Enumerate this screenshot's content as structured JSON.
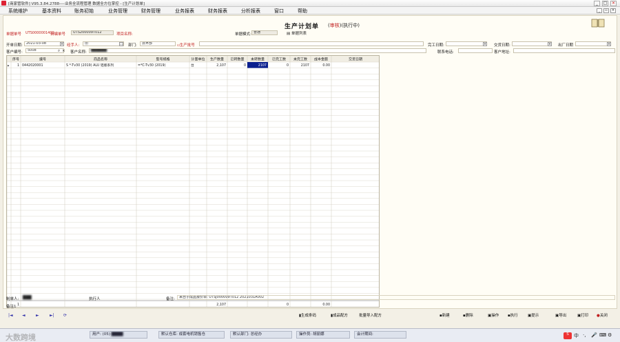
{
  "window": {
    "title": "[商家管软件] V95.3.84.2788----业务全流程管理 数据全方位掌控 - [生产计划单]",
    "controls": [
      "_",
      "□",
      "×"
    ]
  },
  "menu": {
    "items": [
      "系统维护",
      "基本资料",
      "账务初始",
      "业务管理",
      "财务管理",
      "业务报表",
      "财务报表",
      "分析报表",
      "窗口",
      "帮助"
    ]
  },
  "document": {
    "title": "生产计划单",
    "status_open": "(",
    "status_audit": "审核",
    "status_close": ")(执行中)",
    "doc_no_label": "单据单号",
    "doc_no_value": "UTS0000001409",
    "self_no_label": "自编单号",
    "self_no_value": "UTS200009T012",
    "project_label": "项目名称:",
    "mode_label": "单据模式:",
    "mode_value": "普通",
    "doc_list_label": "单据列表",
    "open_date_label": "开单日期:",
    "open_date_value": "2021-03-08",
    "handler_label": "经手人:",
    "handler_value": "曹",
    "dept_label": "部门:",
    "dept_value": "技术部",
    "batch_label": "生产批号",
    "finish_date_label": "完工日期:",
    "delivery_date_label": "交货日期:",
    "factory_date_label": "出厂日期",
    "customer_no_label": "客户编号:",
    "customer_no_value": "5008",
    "customer_name_label": "客户名称:",
    "contact_phone_label": "联系电话:",
    "customer_addr_label": "客户地址:"
  },
  "grid": {
    "columns": [
      "序号",
      "编号",
      "商品名称",
      "型号规格",
      "计量单位",
      "生产数量",
      "已转数量",
      "未转数量",
      "已完工数",
      "未完工数",
      "成本金额",
      "交货日期"
    ],
    "rows": [
      {
        "seq": "1",
        "code": "0442020001",
        "name": "S          *-Tv30 (2019) ALU 铝版系列",
        "spec": "          =*C-Tv30 (2019)",
        "unit": "台",
        "qty": "2,107",
        "transferred": "0",
        "untransferred": "2107",
        "done": "0",
        "undone": "2107",
        "cost": "0.00",
        "delivery": ""
      }
    ],
    "footer": {
      "seq": "1",
      "qty": "2,107",
      "done": "0",
      "cost": "0.00"
    }
  },
  "bottom": {
    "maker_label": "制单人:",
    "executor_label": "执行人",
    "remark_label": "备注:",
    "remark_value": "来自子成品报价单: UTSJ000009T012 2021031A002",
    "remark2_label": "备注1"
  },
  "toolbar": {
    "nav": [
      "|◄",
      "◄",
      "►",
      "►|",
      "⟳"
    ],
    "buttons": [
      "生成条码",
      "成品配方",
      "批量导入配方",
      "新建",
      "删除",
      "操作",
      "执行",
      "提示",
      "导出",
      "打印",
      "关闭"
    ]
  },
  "statusbar": {
    "user_label": "用户:",
    "user_value": "(05)",
    "warehouse_label": "默认仓库:",
    "warehouse_value": "成套电机销售仓",
    "dept_label": "默认部门:",
    "dept_value": "总经办",
    "op_label": "操作员:",
    "op_value": "胡丽娜",
    "acct_label": "会计期间:",
    "acct_value": "",
    "watermark": "大数跨境",
    "ime_label": "中"
  },
  "colors": {
    "accent_red": "#c02020",
    "selected_cell": "#0a1f8f",
    "doc_bg": "#fffdf5"
  }
}
